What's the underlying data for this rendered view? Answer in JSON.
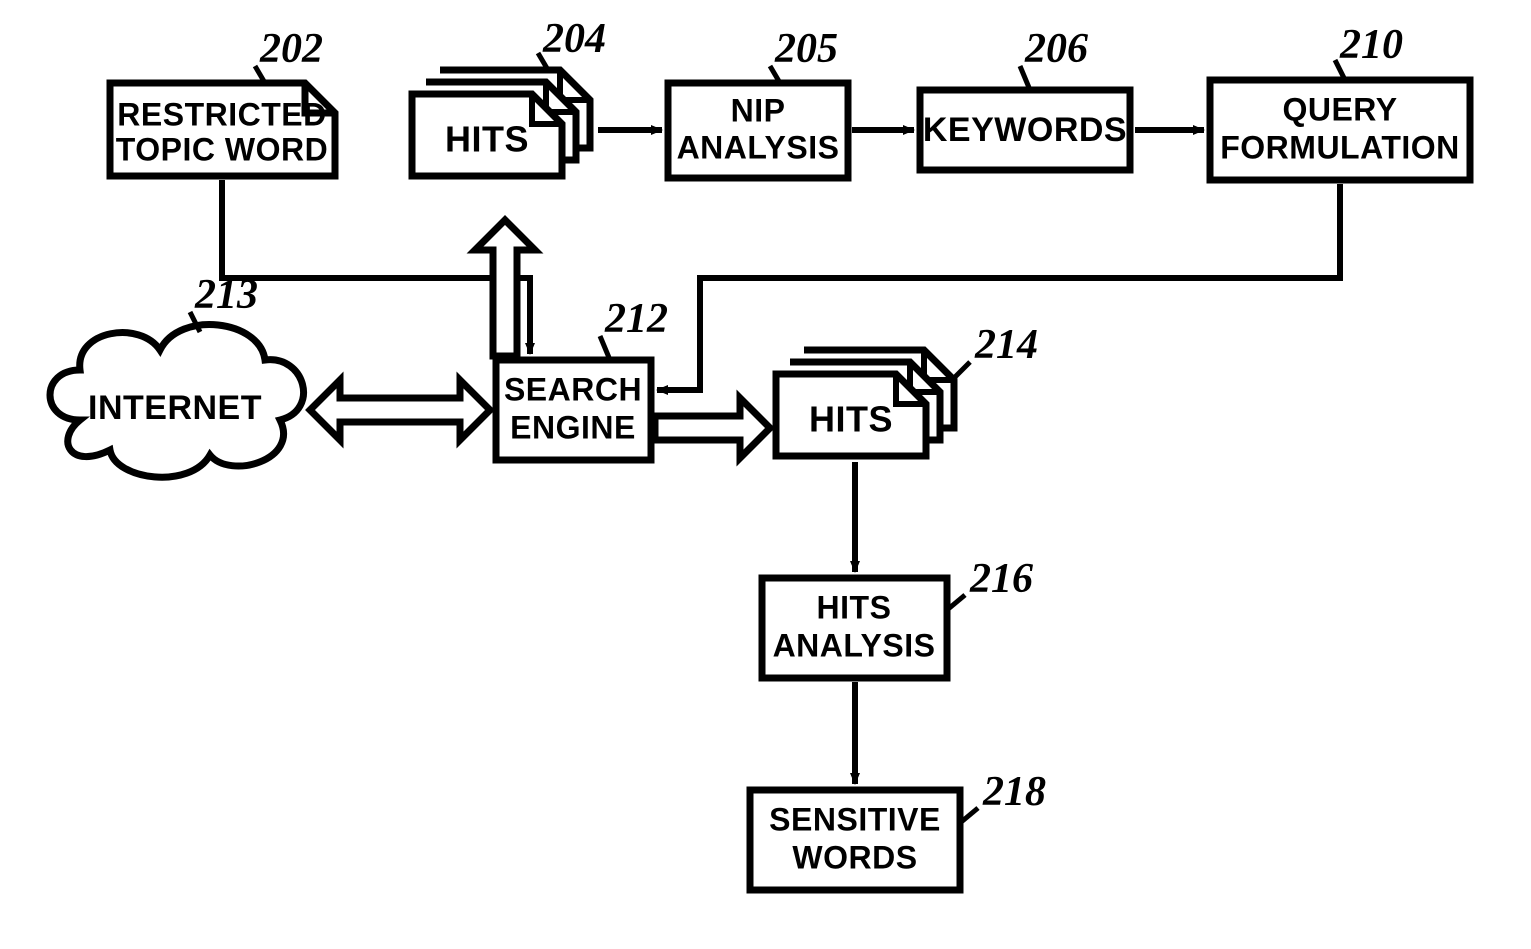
{
  "nodes": {
    "restricted_topic": {
      "ref": "202",
      "text_top": "RESTRICTED",
      "text_bottom": "TOPIC WORD"
    },
    "hits_top": {
      "ref": "204",
      "text": "HITS"
    },
    "nip_analysis": {
      "ref": "205",
      "text_top": "NIP",
      "text_bottom": "ANALYSIS"
    },
    "keywords": {
      "ref": "206",
      "text": "KEYWORDS"
    },
    "query_formulation": {
      "ref": "210",
      "text_top": "QUERY",
      "text_bottom": "FORMULATION"
    },
    "search_engine": {
      "ref": "212",
      "text_top": "SEARCH",
      "text_bottom": "ENGINE"
    },
    "internet": {
      "ref": "213",
      "text": "INTERNET"
    },
    "hits_right": {
      "ref": "214",
      "text": "HITS"
    },
    "hits_analysis": {
      "ref": "216",
      "text_top": "HITS",
      "text_bottom": "ANALYSIS"
    },
    "sensitive_words": {
      "ref": "218",
      "text_top": "SENSITIVE",
      "text_bottom": "WORDS"
    }
  }
}
